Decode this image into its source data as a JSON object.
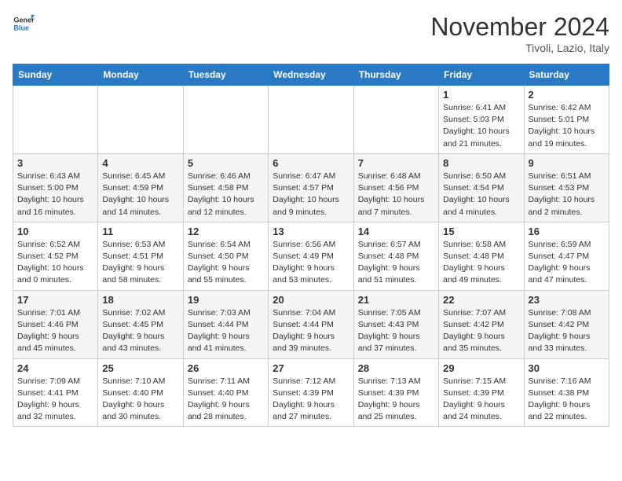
{
  "header": {
    "logo_general": "General",
    "logo_blue": "Blue",
    "month_title": "November 2024",
    "location": "Tivoli, Lazio, Italy"
  },
  "weekdays": [
    "Sunday",
    "Monday",
    "Tuesday",
    "Wednesday",
    "Thursday",
    "Friday",
    "Saturday"
  ],
  "weeks": [
    [
      {
        "day": "",
        "info": ""
      },
      {
        "day": "",
        "info": ""
      },
      {
        "day": "",
        "info": ""
      },
      {
        "day": "",
        "info": ""
      },
      {
        "day": "",
        "info": ""
      },
      {
        "day": "1",
        "info": "Sunrise: 6:41 AM\nSunset: 5:03 PM\nDaylight: 10 hours\nand 21 minutes."
      },
      {
        "day": "2",
        "info": "Sunrise: 6:42 AM\nSunset: 5:01 PM\nDaylight: 10 hours\nand 19 minutes."
      }
    ],
    [
      {
        "day": "3",
        "info": "Sunrise: 6:43 AM\nSunset: 5:00 PM\nDaylight: 10 hours\nand 16 minutes."
      },
      {
        "day": "4",
        "info": "Sunrise: 6:45 AM\nSunset: 4:59 PM\nDaylight: 10 hours\nand 14 minutes."
      },
      {
        "day": "5",
        "info": "Sunrise: 6:46 AM\nSunset: 4:58 PM\nDaylight: 10 hours\nand 12 minutes."
      },
      {
        "day": "6",
        "info": "Sunrise: 6:47 AM\nSunset: 4:57 PM\nDaylight: 10 hours\nand 9 minutes."
      },
      {
        "day": "7",
        "info": "Sunrise: 6:48 AM\nSunset: 4:56 PM\nDaylight: 10 hours\nand 7 minutes."
      },
      {
        "day": "8",
        "info": "Sunrise: 6:50 AM\nSunset: 4:54 PM\nDaylight: 10 hours\nand 4 minutes."
      },
      {
        "day": "9",
        "info": "Sunrise: 6:51 AM\nSunset: 4:53 PM\nDaylight: 10 hours\nand 2 minutes."
      }
    ],
    [
      {
        "day": "10",
        "info": "Sunrise: 6:52 AM\nSunset: 4:52 PM\nDaylight: 10 hours\nand 0 minutes."
      },
      {
        "day": "11",
        "info": "Sunrise: 6:53 AM\nSunset: 4:51 PM\nDaylight: 9 hours\nand 58 minutes."
      },
      {
        "day": "12",
        "info": "Sunrise: 6:54 AM\nSunset: 4:50 PM\nDaylight: 9 hours\nand 55 minutes."
      },
      {
        "day": "13",
        "info": "Sunrise: 6:56 AM\nSunset: 4:49 PM\nDaylight: 9 hours\nand 53 minutes."
      },
      {
        "day": "14",
        "info": "Sunrise: 6:57 AM\nSunset: 4:48 PM\nDaylight: 9 hours\nand 51 minutes."
      },
      {
        "day": "15",
        "info": "Sunrise: 6:58 AM\nSunset: 4:48 PM\nDaylight: 9 hours\nand 49 minutes."
      },
      {
        "day": "16",
        "info": "Sunrise: 6:59 AM\nSunset: 4:47 PM\nDaylight: 9 hours\nand 47 minutes."
      }
    ],
    [
      {
        "day": "17",
        "info": "Sunrise: 7:01 AM\nSunset: 4:46 PM\nDaylight: 9 hours\nand 45 minutes."
      },
      {
        "day": "18",
        "info": "Sunrise: 7:02 AM\nSunset: 4:45 PM\nDaylight: 9 hours\nand 43 minutes."
      },
      {
        "day": "19",
        "info": "Sunrise: 7:03 AM\nSunset: 4:44 PM\nDaylight: 9 hours\nand 41 minutes."
      },
      {
        "day": "20",
        "info": "Sunrise: 7:04 AM\nSunset: 4:44 PM\nDaylight: 9 hours\nand 39 minutes."
      },
      {
        "day": "21",
        "info": "Sunrise: 7:05 AM\nSunset: 4:43 PM\nDaylight: 9 hours\nand 37 minutes."
      },
      {
        "day": "22",
        "info": "Sunrise: 7:07 AM\nSunset: 4:42 PM\nDaylight: 9 hours\nand 35 minutes."
      },
      {
        "day": "23",
        "info": "Sunrise: 7:08 AM\nSunset: 4:42 PM\nDaylight: 9 hours\nand 33 minutes."
      }
    ],
    [
      {
        "day": "24",
        "info": "Sunrise: 7:09 AM\nSunset: 4:41 PM\nDaylight: 9 hours\nand 32 minutes."
      },
      {
        "day": "25",
        "info": "Sunrise: 7:10 AM\nSunset: 4:40 PM\nDaylight: 9 hours\nand 30 minutes."
      },
      {
        "day": "26",
        "info": "Sunrise: 7:11 AM\nSunset: 4:40 PM\nDaylight: 9 hours\nand 28 minutes."
      },
      {
        "day": "27",
        "info": "Sunrise: 7:12 AM\nSunset: 4:39 PM\nDaylight: 9 hours\nand 27 minutes."
      },
      {
        "day": "28",
        "info": "Sunrise: 7:13 AM\nSunset: 4:39 PM\nDaylight: 9 hours\nand 25 minutes."
      },
      {
        "day": "29",
        "info": "Sunrise: 7:15 AM\nSunset: 4:39 PM\nDaylight: 9 hours\nand 24 minutes."
      },
      {
        "day": "30",
        "info": "Sunrise: 7:16 AM\nSunset: 4:38 PM\nDaylight: 9 hours\nand 22 minutes."
      }
    ]
  ]
}
